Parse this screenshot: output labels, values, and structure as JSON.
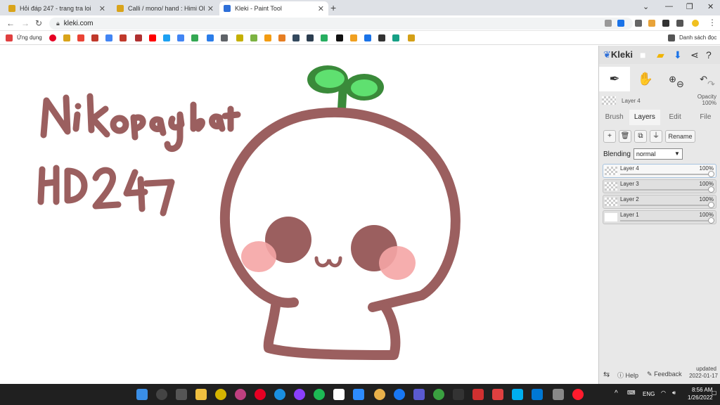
{
  "browser": {
    "tabs": [
      {
        "title": "Hỏi đáp 247 - trang tra loi",
        "active": false
      },
      {
        "title": "Calli / mono/ hand : Himi OR Mã",
        "active": false
      },
      {
        "title": "Kleki - Paint Tool",
        "active": true
      }
    ],
    "url": "kleki.com",
    "bookmarks_apps_label": "Ứng dụng",
    "reading_list_label": "Danh sách đọc",
    "window_controls": [
      "⌄",
      "—",
      "❐",
      "✕"
    ]
  },
  "drawing": {
    "text_line1": "NiKopaybat",
    "text_line2": "HD 247",
    "colors": {
      "outline": "#9b5f5f",
      "eye": "#9b5f5f",
      "blush": "#f5a5a5",
      "leaf": "#4fbf5f",
      "leaf_inner": "#5fe070",
      "stem": "#3a8a3a"
    }
  },
  "kleki": {
    "logo": "Kleki",
    "current_layer": "Layer 4",
    "opacity_label": "Opacity",
    "opacity_value": "100%",
    "tabs": [
      "Brush",
      "Layers",
      "Edit",
      "File"
    ],
    "active_tab": "Layers",
    "rename_label": "Rename",
    "blending_label": "Blending",
    "blending_value": "normal",
    "layers": [
      {
        "name": "Layer 4",
        "opacity": "100%",
        "selected": true
      },
      {
        "name": "Layer 3",
        "opacity": "100%",
        "selected": false
      },
      {
        "name": "Layer 2",
        "opacity": "100%",
        "selected": false
      },
      {
        "name": "Layer 1",
        "opacity": "100%",
        "selected": false
      }
    ],
    "footer": {
      "help": "Help",
      "feedback": "Feedback",
      "updated_label": "updated",
      "updated_date": "2022-01-17"
    }
  },
  "taskbar": {
    "language": "ENG",
    "time": "8:56 AM",
    "date": "1/26/2022"
  }
}
